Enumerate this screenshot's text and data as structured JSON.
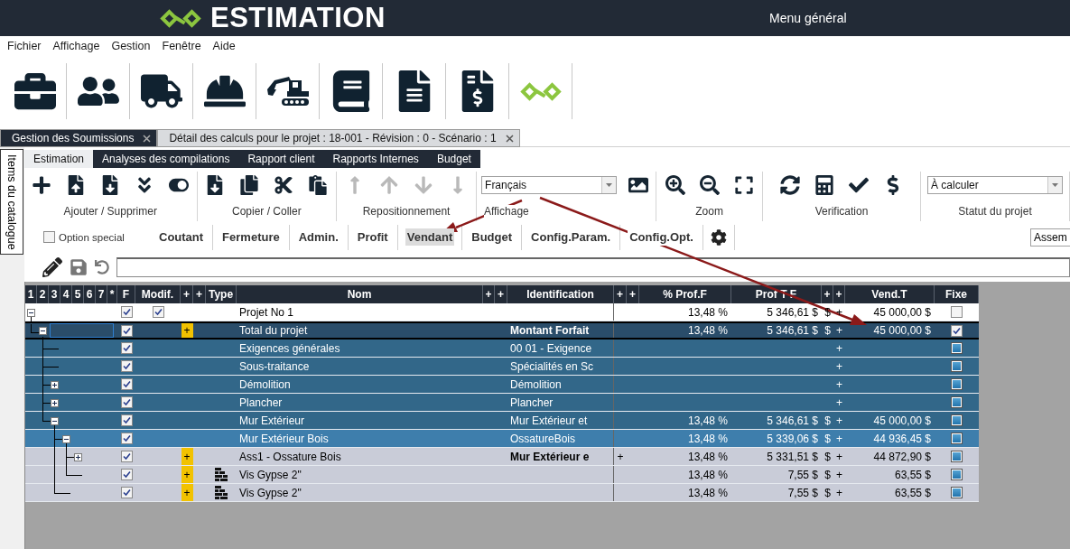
{
  "app": {
    "title": "ESTIMATION",
    "menu_link": "Menu général"
  },
  "menu": [
    "Fichier",
    "Affichage",
    "Gestion",
    "Fenêtre",
    "Aide"
  ],
  "doc_tabs": [
    {
      "label": "Gestion des Soumissions",
      "selected": false
    },
    {
      "label": "Détail des calculs pour le projet : 18-001 - Révision : 0 - Scénario : 1",
      "selected": true
    }
  ],
  "side_tab": {
    "label": "Items du catalogue"
  },
  "ribbon_tabs": [
    {
      "label": "Estimation",
      "selected": true
    },
    {
      "label": "Analyses des compilations",
      "selected": false
    },
    {
      "label": "Rapport client",
      "selected": false
    },
    {
      "label": "Rapports Internes",
      "selected": false
    },
    {
      "label": "Budget",
      "selected": false
    }
  ],
  "toolbar_groups": [
    {
      "label": "Ajouter / Supprimer",
      "kind": "icons",
      "disabled": false
    },
    {
      "label": "Copier / Coller",
      "kind": "icons",
      "disabled": false
    },
    {
      "label": "Repositionnement",
      "kind": "icons",
      "disabled": true
    },
    {
      "label": "Affichage",
      "kind": "dropdown",
      "value": "Français",
      "disabled": false
    },
    {
      "label": "Zoom",
      "kind": "icons",
      "disabled": false
    },
    {
      "label": "Verification",
      "kind": "icons",
      "disabled": false
    },
    {
      "label": "Statut du projet",
      "kind": "dropdown",
      "value": "À calculer",
      "disabled": false
    }
  ],
  "option_special": {
    "label": "Option special",
    "checked": false
  },
  "views": [
    {
      "label": "Coutant",
      "selected": false
    },
    {
      "label": "Fermeture",
      "selected": false
    },
    {
      "label": "Admin.",
      "selected": false
    },
    {
      "label": "Profit",
      "selected": false
    },
    {
      "label": "Vendant",
      "selected": true
    },
    {
      "label": "Budget",
      "selected": false
    },
    {
      "label": "Config.Param.",
      "selected": false
    },
    {
      "label": "Config.Opt.",
      "selected": false
    }
  ],
  "assembly_dropdown": {
    "value": "Assem"
  },
  "table": {
    "columns": [
      "1",
      "2",
      "3",
      "4",
      "5",
      "6",
      "7",
      "*",
      "F",
      "Modif.",
      "+",
      "+",
      "Type",
      "Nom",
      "+",
      "+",
      "Identification",
      "+",
      "+",
      "% Prof.F",
      "Prof T F",
      "+",
      "+",
      "Vend.T",
      "Fixe"
    ],
    "rows": [
      {
        "name": "Projet No 1",
        "kind": "project",
        "selected": false,
        "expanded": true,
        "f_checked": true,
        "modif_checked": true,
        "prof_f": "13,48 %",
        "prof_t_f": "5 346,61 $",
        "currency": "$",
        "plus": "+",
        "vend_t": "45 000,00 $",
        "fixe_checked": false,
        "children": [
          {
            "name": "Total du projet",
            "kind": "total",
            "selected": true,
            "expanded": true,
            "f_checked": true,
            "badge": "+",
            "identification": "Montant Forfait",
            "prof_f": "13,48 %",
            "prof_t_f": "5 346,61 $",
            "currency": "$",
            "plus": "+",
            "vend_t": "45 000,00 $",
            "fixe_checked": true,
            "children": [
              {
                "name": "Exigences générales",
                "kind": "group",
                "selected": false,
                "f_checked": true,
                "identification": "00 01 - Exigence",
                "plus": "+",
                "fixe_checked": false
              },
              {
                "name": "Sous-traitance",
                "kind": "group",
                "selected": false,
                "f_checked": true,
                "identification": "Spécialités en Sc",
                "plus": "+",
                "fixe_checked": false
              },
              {
                "name": "Démolition",
                "kind": "group",
                "selected": false,
                "expanded": false,
                "f_checked": true,
                "identification": "Démolition",
                "plus": "+",
                "fixe_checked": false
              },
              {
                "name": "Plancher",
                "kind": "group",
                "selected": false,
                "expanded": false,
                "f_checked": true,
                "identification": "Plancher",
                "plus": "+",
                "fixe_checked": false
              },
              {
                "name": "Mur Extérieur",
                "kind": "group",
                "selected": false,
                "expanded": true,
                "f_checked": true,
                "identification": "Mur Extérieur et",
                "prof_f": "13,48 %",
                "prof_t_f": "5 346,61 $",
                "currency": "$",
                "plus": "+",
                "vend_t": "45 000,00 $",
                "fixe_checked": false,
                "children": [
                  {
                    "name": "Mur Extérieur Bois",
                    "kind": "subgroup",
                    "selected": false,
                    "expanded": true,
                    "f_checked": true,
                    "identification": "OssatureBois",
                    "prof_f": "13,48 %",
                    "prof_t_f": "5 339,06 $",
                    "currency": "$",
                    "plus": "+",
                    "vend_t": "44 936,45 $",
                    "fixe_checked": false,
                    "children": [
                      {
                        "name": "Ass1 - Ossature Bois",
                        "kind": "assembly",
                        "selected": false,
                        "expanded": false,
                        "f_checked": true,
                        "badge": "+",
                        "identification": "Mur Extérieur e",
                        "identification_plus": "+",
                        "prof_f": "13,48 %",
                        "prof_t_f": "5 331,51 $",
                        "currency": "$",
                        "plus": "+",
                        "vend_t": "44 872,90 $",
                        "fixe_checked": false
                      },
                      {
                        "name": "Vis Gypse 2\"",
                        "kind": "item",
                        "selected": false,
                        "f_checked": true,
                        "badge": "+",
                        "type_icon": true,
                        "prof_f": "13,48 %",
                        "prof_t_f": "7,55 $",
                        "currency": "$",
                        "plus": "+",
                        "vend_t": "63,55 $",
                        "fixe_checked": false
                      }
                    ]
                  },
                  {
                    "name": "Vis Gypse 2\"",
                    "kind": "item",
                    "selected": false,
                    "f_checked": true,
                    "badge": "+",
                    "type_icon": true,
                    "prof_f": "13,48 %",
                    "prof_t_f": "7,55 $",
                    "currency": "$",
                    "plus": "+",
                    "vend_t": "63,55 $",
                    "fixe_checked": false
                  }
                ]
              }
            ]
          }
        ]
      }
    ]
  }
}
